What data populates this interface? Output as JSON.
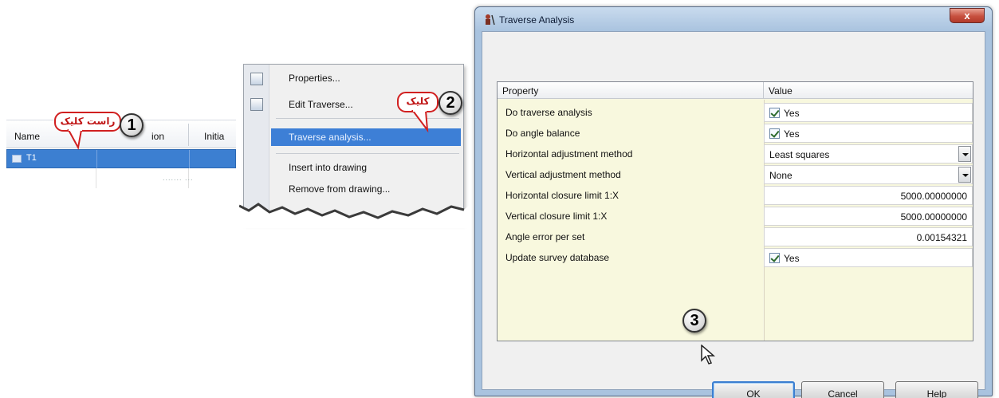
{
  "list": {
    "columns": [
      "Name",
      "ion",
      "Initia"
    ],
    "rows": [
      {
        "name": "T1"
      }
    ],
    "faint_row_text": "....... ..."
  },
  "callouts": {
    "one": {
      "number": "1",
      "text": "راست کلیک"
    },
    "two": {
      "number": "2",
      "text": "کلیک"
    },
    "three": {
      "number": "3"
    }
  },
  "context_menu": {
    "items": [
      {
        "label": "Properties...",
        "icon": "properties-icon"
      },
      {
        "label": "Edit Traverse...",
        "icon": "edit-traverse-icon"
      },
      {
        "label": "Traverse analysis...",
        "highlighted": true
      },
      {
        "label": "Insert into drawing"
      },
      {
        "label": "Remove from drawing..."
      }
    ]
  },
  "dialog": {
    "title": "Traverse Analysis",
    "close_label": "x",
    "grid": {
      "headers": {
        "property": "Property",
        "value": "Value"
      },
      "rows": [
        {
          "label": "Do traverse analysis",
          "type": "checkbox",
          "value": "Yes",
          "checked": true
        },
        {
          "label": "Do angle balance",
          "type": "checkbox",
          "value": "Yes",
          "checked": true
        },
        {
          "label": "Horizontal adjustment method",
          "type": "dropdown",
          "value": "Least squares"
        },
        {
          "label": "Vertical adjustment method",
          "type": "dropdown",
          "value": "None"
        },
        {
          "label": "Horizontal closure limit 1:X",
          "type": "number",
          "value": "5000.00000000"
        },
        {
          "label": "Vertical closure limit 1:X",
          "type": "number",
          "value": "5000.00000000"
        },
        {
          "label": "Angle error per set",
          "type": "number",
          "value": "0.00154321"
        },
        {
          "label": "Update survey database",
          "type": "checkbox",
          "value": "Yes",
          "checked": true
        }
      ]
    },
    "buttons": {
      "ok": "OK",
      "cancel": "Cancel",
      "help": "Help"
    }
  },
  "colors": {
    "selection": "#3c7fd1",
    "callout_red": "#d12020",
    "grid_bg": "#f8f8de",
    "dialog_frame": "#a9c3df"
  }
}
